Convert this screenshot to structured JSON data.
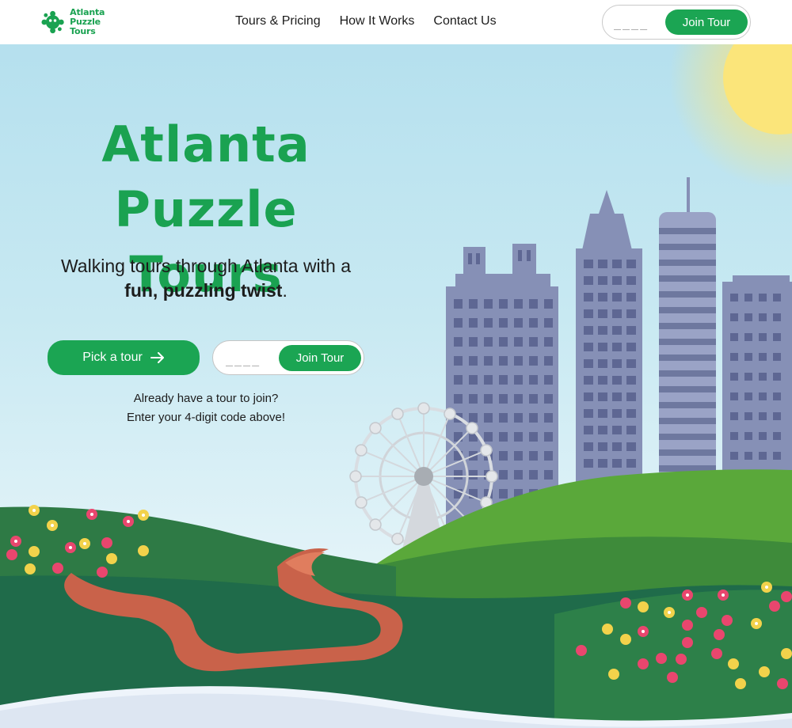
{
  "nav": {
    "logo_line1": "Atlanta",
    "logo_line2": "Puzzle Tours",
    "links": [
      "Tours & Pricing",
      "How It Works",
      "Contact Us"
    ],
    "code_placeholder": "____",
    "join_label": "Join Tour"
  },
  "hero": {
    "title_line1": "Atlanta",
    "title_line2": "Puzzle Tours",
    "subtitle_plain": "Walking tours through Atlanta with a",
    "subtitle_bold": "fun, puzzling twist",
    "subtitle_end": ".",
    "pick_label": "Pick a tour",
    "code_placeholder": "____",
    "join_label": "Join Tour",
    "hint_line1": "Already have a tour to join?",
    "hint_line2": "Enter your 4-digit code above!"
  },
  "colors": {
    "brand_green": "#1ba553",
    "sky": "#b5e0ee",
    "sun": "#fbe57a",
    "building": "#8690b6",
    "hill_dark": "#1f6b4a",
    "hill_light": "#4fa23c",
    "path": "#c9624a"
  },
  "icons": [
    "logo-icon",
    "arrow-right-icon"
  ]
}
